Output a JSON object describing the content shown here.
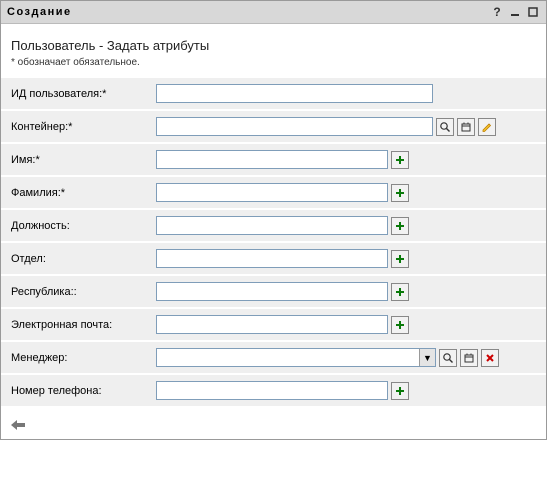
{
  "window": {
    "title": "Создание"
  },
  "page": {
    "heading": "Пользователь - Задать атрибуты",
    "required_note": "* обозначает обязательное."
  },
  "fields": {
    "user_id": {
      "label": "ИД пользователя:*",
      "value": ""
    },
    "container": {
      "label": "Контейнер:*",
      "value": ""
    },
    "firstname": {
      "label": "Имя:*",
      "value": ""
    },
    "lastname": {
      "label": "Фамилия:*",
      "value": ""
    },
    "title": {
      "label": "Должность:",
      "value": ""
    },
    "dept": {
      "label": "Отдел:",
      "value": ""
    },
    "state": {
      "label": "Республика::",
      "value": ""
    },
    "email": {
      "label": "Электронная почта:",
      "value": ""
    },
    "manager": {
      "label": "Менеджер:",
      "value": ""
    },
    "phone": {
      "label": "Номер телефона:",
      "value": ""
    }
  }
}
